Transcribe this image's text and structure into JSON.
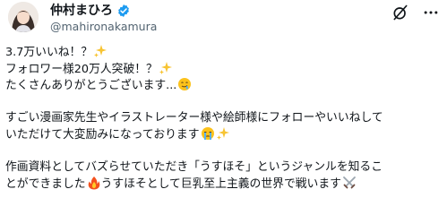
{
  "author": {
    "display_name": "仲村まひろ",
    "handle": "@mahironakamura"
  },
  "icons": {
    "verified": "verified-badge-icon",
    "grok": "grok-icon",
    "more": "more-options-icon"
  },
  "colors": {
    "verified_blue": "#1d9bf0",
    "text": "#0f1419",
    "secondary_text": "#536471"
  },
  "post": {
    "line1": "3.7万いいね！？",
    "line2": "フォロワー様20万人突破！？",
    "line3": "たくさんありがとうございます...",
    "line4": "すごい漫画家先生やイラストレーター様や絵師様にフォローやいいねして",
    "line5": "いただけて大変励みになっております",
    "line6": "作画資料としてバズらせていただき「うすほそ」というジャンルを知るこ",
    "line7a": "とができました",
    "line7b": "うすほそとして巨乳至上主義の世界で戦います"
  }
}
